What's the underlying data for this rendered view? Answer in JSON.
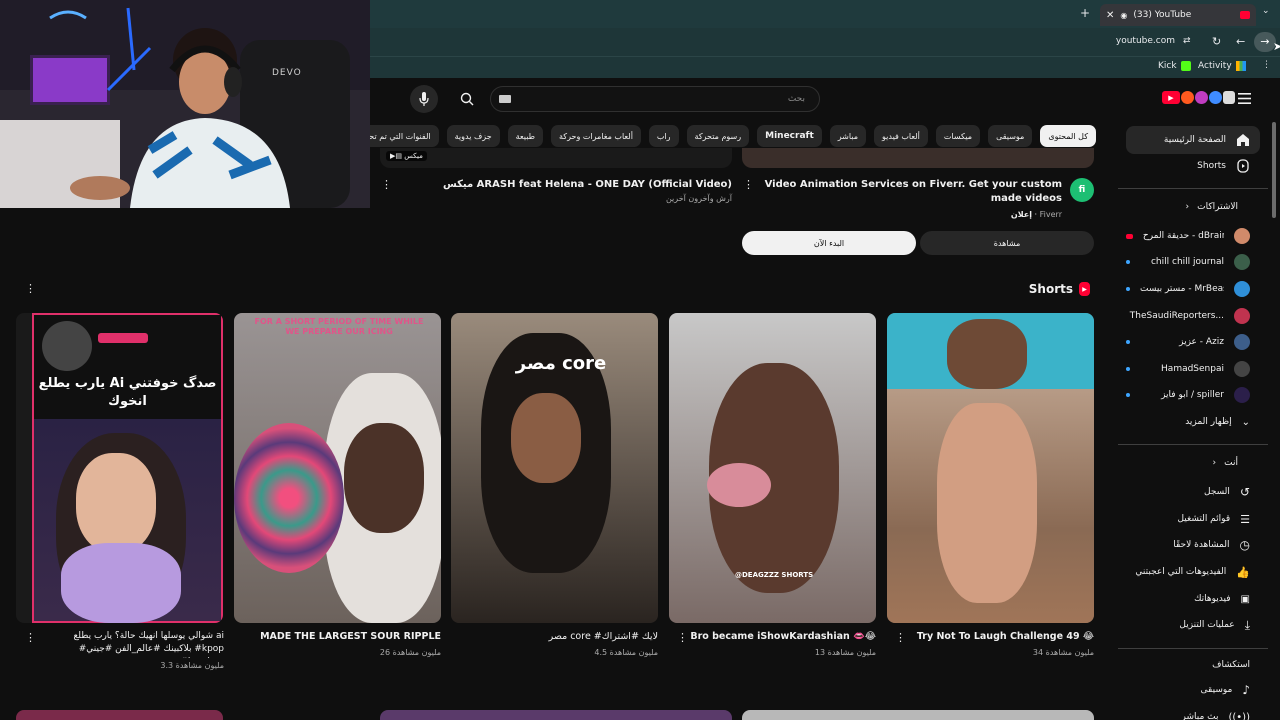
{
  "browser": {
    "tab_title": "(33) YouTube",
    "url": "youtube.com",
    "bookmarks": [
      {
        "label": "Kick"
      },
      {
        "label": "Activity"
      }
    ]
  },
  "streamer": {
    "chair_brand": "DEVO"
  },
  "header": {
    "search_placeholder": "بحث"
  },
  "chips": [
    {
      "label": "كل المحتوى",
      "selected": true
    },
    {
      "label": "موسيقى"
    },
    {
      "label": "ميكسات"
    },
    {
      "label": "ألعاب فيديو"
    },
    {
      "label": "مباشر"
    },
    {
      "label": "Minecraft"
    },
    {
      "label": "رسوم متحركة"
    },
    {
      "label": "راب"
    },
    {
      "label": "ألعاب مغامرات وحركة"
    },
    {
      "label": "طبيعة"
    },
    {
      "label": "جزف يدوية"
    },
    {
      "label": "الفنوات التي تم تحميلها مؤخرًا"
    }
  ],
  "top_row": {
    "ad": {
      "title": "Video Animation Services on Fiverr. Get your custom made videos",
      "badge": "إعلان",
      "advertiser": "Fiverr",
      "watch_label": "مشاهدة",
      "start_label": "البدء الآن"
    },
    "mix": {
      "badge": "ميكس",
      "title": "ميكس ARASH feat Helena - ONE DAY (Official Video)",
      "meta": "آرش وآخرون آخرين"
    }
  },
  "shorts": {
    "heading": "Shorts",
    "items": [
      {
        "title": "Try Not To Laugh Challenge 49 😂",
        "views": "34 مليون مشاهدة"
      },
      {
        "title": "Bro became iShowKardashian 👄😂",
        "views": "13 مليون مشاهدة"
      },
      {
        "title": "مصر core #لايك #اشتراك",
        "views": "4.5 مليون مشاهدة",
        "overlay": "مصر core"
      },
      {
        "title": "MADE THE LARGEST SOUR RIPPLE !!",
        "views": "26 مليون مشاهدة",
        "overlay": "FOR A SHORT PERIOD OF TIME WHILE WE PREPARE OUR ICING"
      },
      {
        "title": "شوالي يوسلها انهيك حالة؟ يارب يطلع ai #بلاكبينك #عالم_الفن #جيني #kpop #jennie...",
        "views": "3.3 مليون مشاهدة",
        "overlay": "يارب يطلع Ai صدگ خوفتني انخوك"
      }
    ],
    "watermark": "@DEAGZZZ SHORTS"
  },
  "sidebar": {
    "main": [
      {
        "label": "الصفحة الرئيسية",
        "icon": "home-icon"
      },
      {
        "label": "Shorts",
        "icon": "shorts-icon"
      }
    ],
    "subs_heading": "الاشتراكات",
    "subs": [
      {
        "label": "حديقة المرح - dBrain...",
        "color": "#d08a6a"
      },
      {
        "label": "chill chill journal",
        "color": "#3b5f4a"
      },
      {
        "label": "مستر بيست - MrBeast",
        "color": "#2f8fd8"
      },
      {
        "label": "TheSaudiReporters...",
        "color": "#c0334f"
      },
      {
        "label": "عزيز - Aziz",
        "color": "#3d5e8a"
      },
      {
        "label": "HamadSenpai",
        "color": "#444444"
      },
      {
        "label": "ابو فايز / spiller",
        "color": "#2b1f4a"
      }
    ],
    "show_more": "إظهار المزيد",
    "you_heading": "أنت",
    "you": [
      {
        "label": "السجل",
        "icon": "history-icon"
      },
      {
        "label": "قوائم التشغيل",
        "icon": "playlist-icon"
      },
      {
        "label": "المشاهدة لاحقًا",
        "icon": "clock-icon"
      },
      {
        "label": "الفيديوهات التي أعجبتني",
        "icon": "like-icon"
      },
      {
        "label": "فيديوهاتك",
        "icon": "video-icon"
      },
      {
        "label": "عمليات التنزيل",
        "icon": "download-icon"
      }
    ],
    "explore_heading": "استكشاف",
    "explore": [
      {
        "label": "موسيقى",
        "icon": "music-icon"
      },
      {
        "label": "بث مباشر",
        "icon": "live-icon"
      }
    ]
  },
  "colors": {
    "accent": "#ff0033",
    "chrome": "#1f3a3d"
  }
}
